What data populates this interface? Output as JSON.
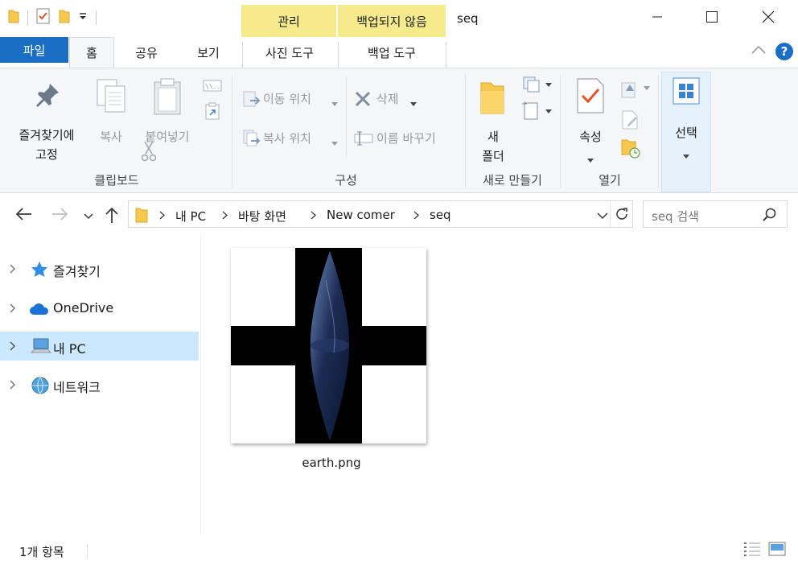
{
  "window": {
    "title": "seq",
    "context_tabs": [
      "관리",
      "백업되지 않음"
    ],
    "context_color": "#f5eb8c"
  },
  "tabs": {
    "file": "파일",
    "items": [
      "홈",
      "공유",
      "보기",
      "사진 도구",
      "백업 도구"
    ]
  },
  "ribbon": {
    "clipboard": {
      "pin_line1": "즐겨찾기에",
      "pin_line2": "고정",
      "copy": "복사",
      "paste": "붙여넣기",
      "group": "클립보드"
    },
    "organize": {
      "move_to": "이동 위치",
      "copy_to": "복사 위치",
      "delete": "삭제",
      "rename": "이름 바꾸기",
      "group": "구성"
    },
    "new": {
      "new_line1": "새",
      "new_line2": "폴더",
      "group": "새로 만들기"
    },
    "open": {
      "properties": "속성",
      "group": "열기"
    },
    "select": {
      "label": "선택"
    }
  },
  "address": {
    "crumbs": [
      "내 PC",
      "바탕 화면",
      "New comer",
      "seq"
    ],
    "search_placeholder": "seq 검색"
  },
  "nav": {
    "items": [
      "즐겨찾기",
      "OneDrive",
      "내 PC",
      "네트워크"
    ],
    "selected": "내 PC"
  },
  "files": [
    {
      "name": "earth.png"
    }
  ],
  "status": {
    "count": "1개 항목"
  },
  "colors": {
    "accent": "#1a6fc4",
    "selection": "#cce8ff",
    "help": "#1a6fc4"
  }
}
